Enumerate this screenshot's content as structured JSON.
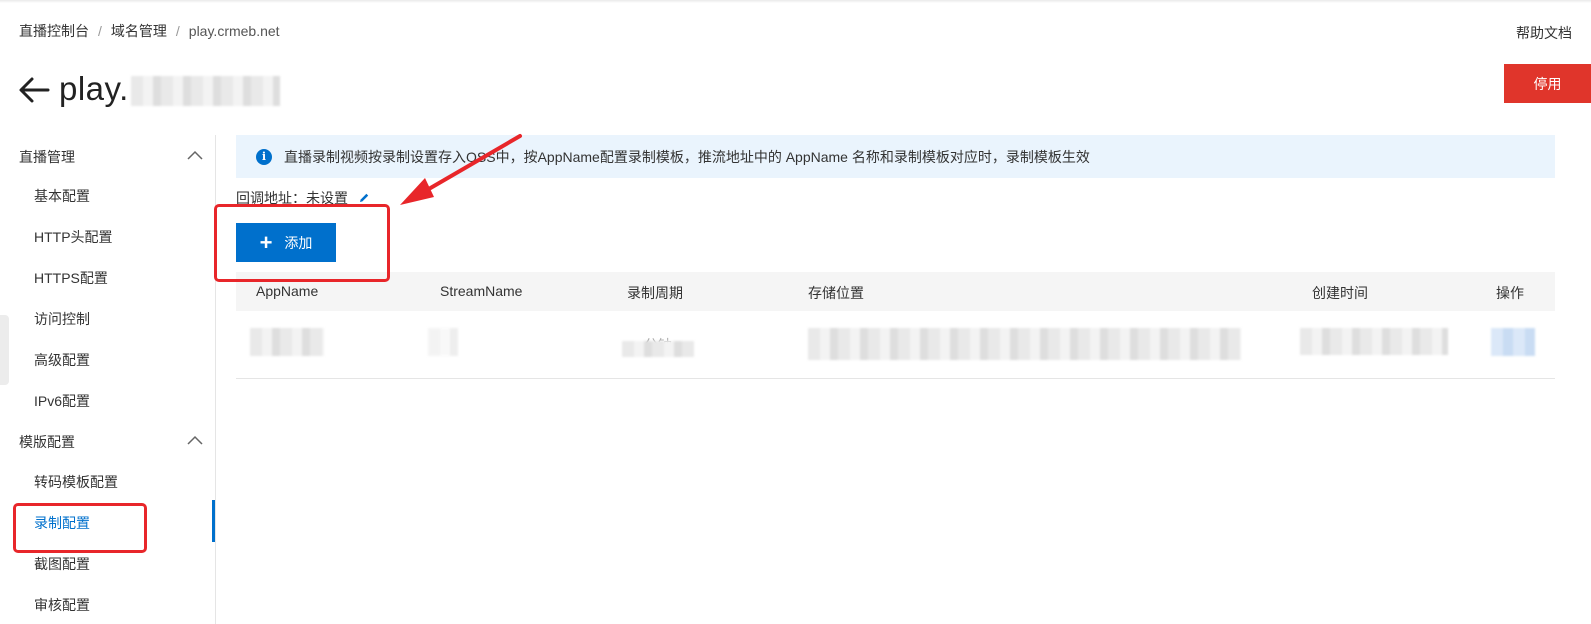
{
  "breadcrumb": {
    "items": [
      "直播控制台",
      "域名管理",
      "play.crmeb.net"
    ],
    "separator": "/"
  },
  "help_link": "帮助文档",
  "page": {
    "title_prefix": "play.",
    "disable_button": "停用"
  },
  "sidebar": {
    "groups": [
      {
        "label": "直播管理",
        "items": [
          "基本配置",
          "HTTP头配置",
          "HTTPS配置",
          "访问控制",
          "高级配置",
          "IPv6配置"
        ]
      },
      {
        "label": "模版配置",
        "items": [
          "转码模板配置",
          "录制配置",
          "截图配置",
          "审核配置"
        ]
      }
    ],
    "active_item": "录制配置"
  },
  "notice": {
    "text": "直播录制视频按录制设置存入OSS中，按AppName配置录制模板，推流地址中的 AppName 名称和录制模板对应时，录制模板生效"
  },
  "callback": {
    "label": "回调地址：",
    "value": "未设置"
  },
  "add_button": "添加",
  "table": {
    "columns": [
      "AppName",
      "StreamName",
      "录制周期",
      "存储位置",
      "创建时间",
      "操作"
    ],
    "rows": [
      {
        "period_fragment": "分钟"
      }
    ]
  },
  "colors": {
    "primary": "#0070cc",
    "danger": "#e0352b",
    "annotation": "#e8262a",
    "notice_bg": "#eaf4fd"
  }
}
